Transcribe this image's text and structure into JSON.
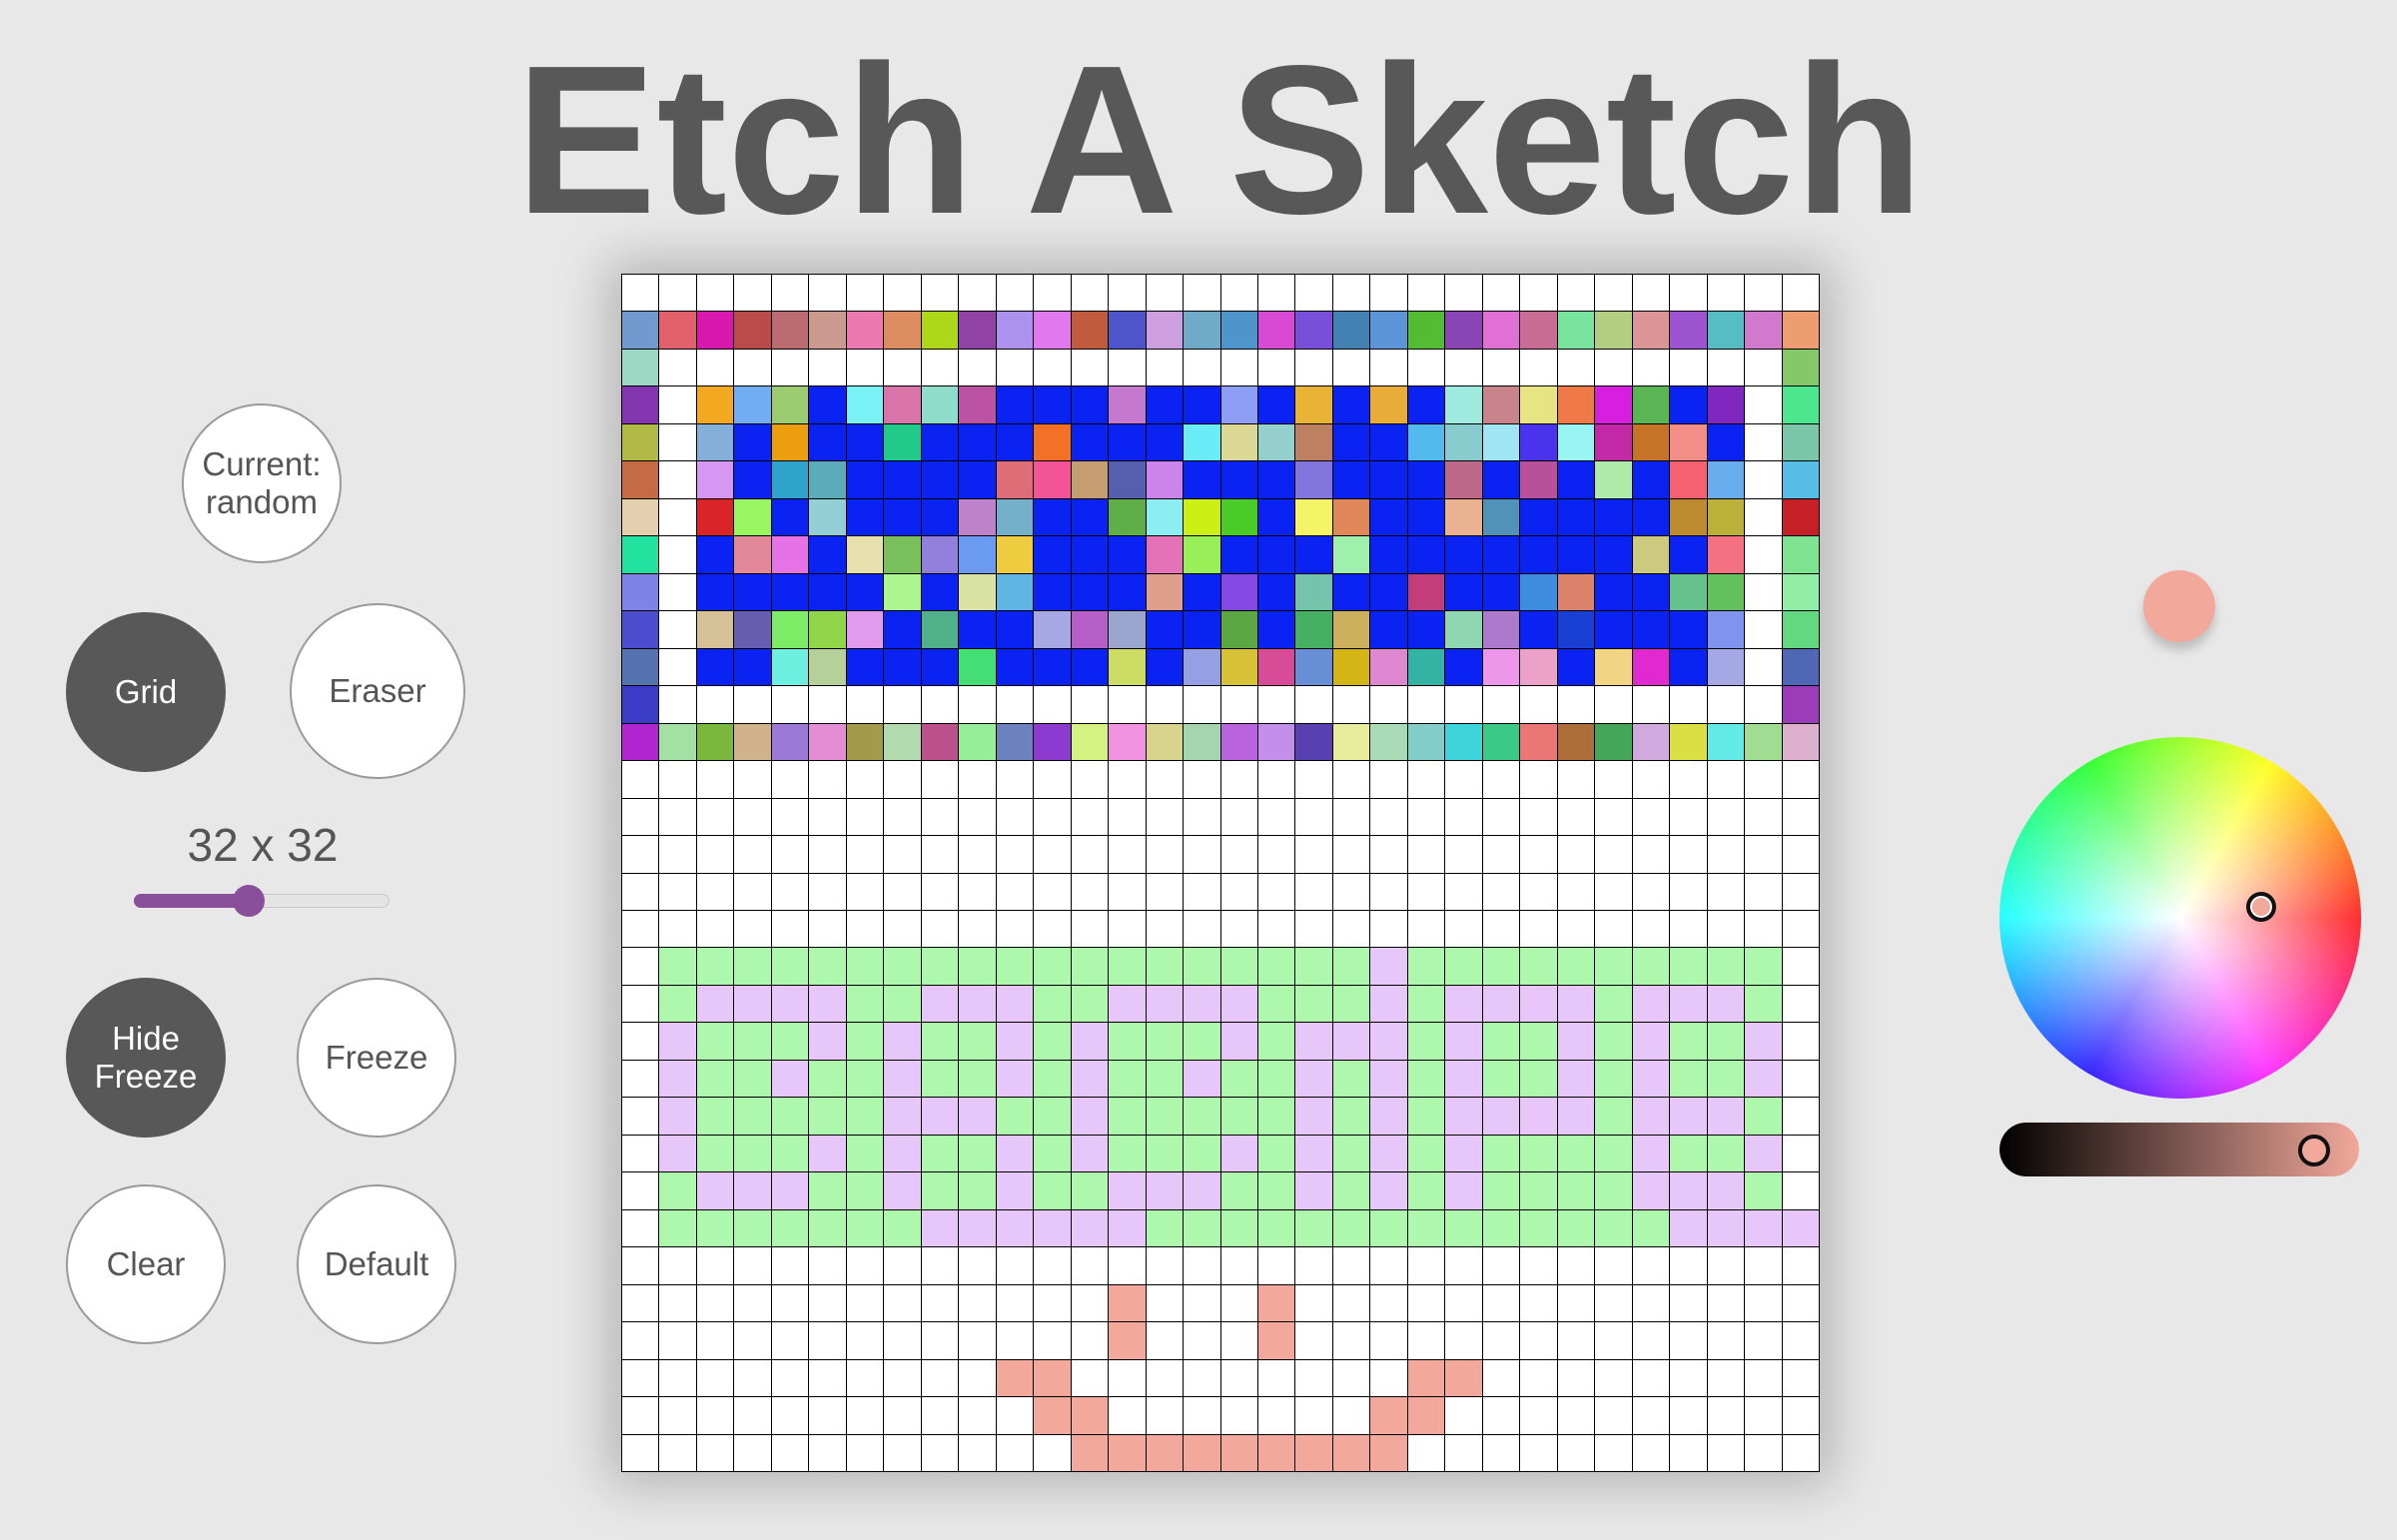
{
  "app": {
    "title": "Etch A Sketch"
  },
  "controls": {
    "mode_label": "Current:\nrandom",
    "grid_label": "Grid",
    "eraser_label": "Eraser",
    "size_label": "32 x 32",
    "size_slider": {
      "value": 32,
      "fraction": 0.45
    },
    "hide_freeze_label": "Hide\nFreeze",
    "freeze_label": "Freeze",
    "clear_label": "Clear",
    "default_label": "Default"
  },
  "colors": {
    "accent": "#8a4f9a",
    "selected_color": "#f2a89b",
    "button_dark": "#585858",
    "text": "#555555",
    "background": "#e8e8e8",
    "blue": "#0a22f2",
    "green": "#adf8ad",
    "pink": "#e7c7f9",
    "salmon": "#f2a89b"
  },
  "picker": {
    "wheel_hue_deg": 8,
    "wheel_saturation": 0.45,
    "brightness": 0.94
  },
  "grid": {
    "size": 32,
    "palette": {
      ".": "#ffffff",
      "B": "#0a22f2",
      "G": "#adf8ad",
      "P": "#e7c7f9",
      "S": "#f2a89b"
    },
    "rows": [
      "................................",
      "################################",
      "#..............................#",
      "#.BBBBBBBBBBBBBBBBBBBBBBBBBBBB.#",
      "#.BBBBBBBBBBBBBBBBBBBBBBBBBBBB.#",
      "#.BBBBBBBBBBBBBBBBBBBBBBBBBBBB.#",
      "#.BBBBBBBBBBBBBBBBBBBBBBBBBBBB.#",
      "#.BBBBBBBBBBBBBBBBBBBBBBBBBBBB.#",
      "#.BBBBBBBBBBBBBBBBBBBBBBBBBBBB.#",
      "#.BBBBBBBBBBBBBBBBBBBBBBBBBBBB.#",
      "#.BBBBBBBBBBBBBBBBBBBBBBBBBBBB.#",
      "#..............................#",
      "################################",
      "................................",
      "................................",
      "................................",
      "................................",
      "................................",
      ".GGGGGGGGGGGGGGGGGGGPGGGGGGGGGG.",
      ".GPPPPGGPPPGGPPPPGGGPGPPPPGPPPG.",
      ".PGGGPGPGGPGPGGGPGPPPGPGGPGPGGP.",
      ".PGGPGGPGGPGPGGPGGPGPGPGGPGPGGP.",
      ".PGGGGGPPPGGPGGGGGPGPGPPPPGPPPG.",
      ".PGGGPGPGGPGPGGGPGPGPGPGGGGPGGP.",
      ".GPPPGGPGGPGGPPPGGPGPGPGGGGPPPG.",
      ".GGGGGGGPPPPPPGGGGGGGGGGGGGGPPPP",
      "................................",
      ".............S...S..............",
      ".............S...S..............",
      "..........SS.........SS.........",
      "...........SS.......SS..........",
      "............SSSSSSSSS..........."
    ]
  }
}
